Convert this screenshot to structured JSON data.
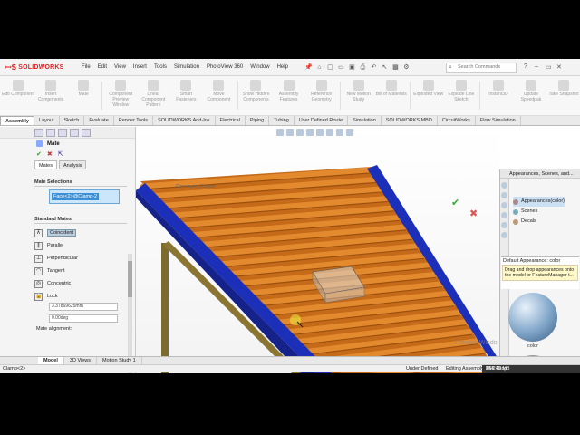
{
  "app": {
    "brand": "SOLIDWORKS",
    "menus": [
      "File",
      "Edit",
      "View",
      "Insert",
      "Tools",
      "Simulation",
      "PhotoView 360",
      "Window",
      "Help"
    ],
    "search_placeholder": "Search Commands"
  },
  "command_manager": [
    "Edit Component",
    "Insert Components",
    "Mate",
    "Component Preview Window",
    "Linear Component Pattern",
    "Smart Fasteners",
    "Move Component",
    "Show Hidden Components",
    "Assembly Features",
    "Reference Geometry",
    "New Motion Study",
    "Bill of Materials",
    "Exploded View",
    "Explode Line Sketch",
    "Instant3D",
    "Update Speedpak",
    "Take Snapshot"
  ],
  "tabs": [
    "Assembly",
    "Layout",
    "Sketch",
    "Evaluate",
    "Render Tools",
    "SOLIDWORKS Add-Ins",
    "Electrical",
    "Piping",
    "Tubing",
    "User Defined Route",
    "Simulation",
    "SOLIDWORKS MBD",
    "CircuitWorks",
    "Flow Simulation"
  ],
  "active_tab": "Assembly",
  "property_manager": {
    "title": "Mate",
    "subtabs": [
      "Mates",
      "Analysis"
    ],
    "mate_selections_title": "Mate Selections",
    "selection": "Face<2>@Clamp-2",
    "standard_mates_title": "Standard Mates",
    "mates": [
      "Coincident",
      "Parallel",
      "Perpendicular",
      "Tangent",
      "Concentric",
      "Lock"
    ],
    "distance_value": "3.37869625mm",
    "angle_value": "0.00deg",
    "mate_alignment": "Mate alignment:"
  },
  "viewport": {
    "breadcrumb": "Conveyor_Assem"
  },
  "task_pane": {
    "header": "Appearances, Scenes, and...",
    "tree": [
      "Appearances(color)",
      "Scenes",
      "Decals"
    ],
    "desc_title": "Default Appearance: color",
    "desc_text": "Drag and drop appearances onto the model or FeatureManager t...",
    "swatches": [
      "color",
      "texture"
    ]
  },
  "bottom_tabs": [
    "Model",
    "3D Views",
    "Motion Study 1"
  ],
  "active_bottom_tab": "Model",
  "status": {
    "left": "Clamp<2>",
    "state": "Under Defined",
    "mode": "Editing Assembly",
    "time": "35:24",
    "size": "144.78 MB",
    "f11": "F11: Stop"
  },
  "watermark": "Activate Windo",
  "colors": {
    "rail": "#1c2fb8",
    "roller": "#d97a1f",
    "leg": "#7d6a2e",
    "accent": "#d22222"
  }
}
